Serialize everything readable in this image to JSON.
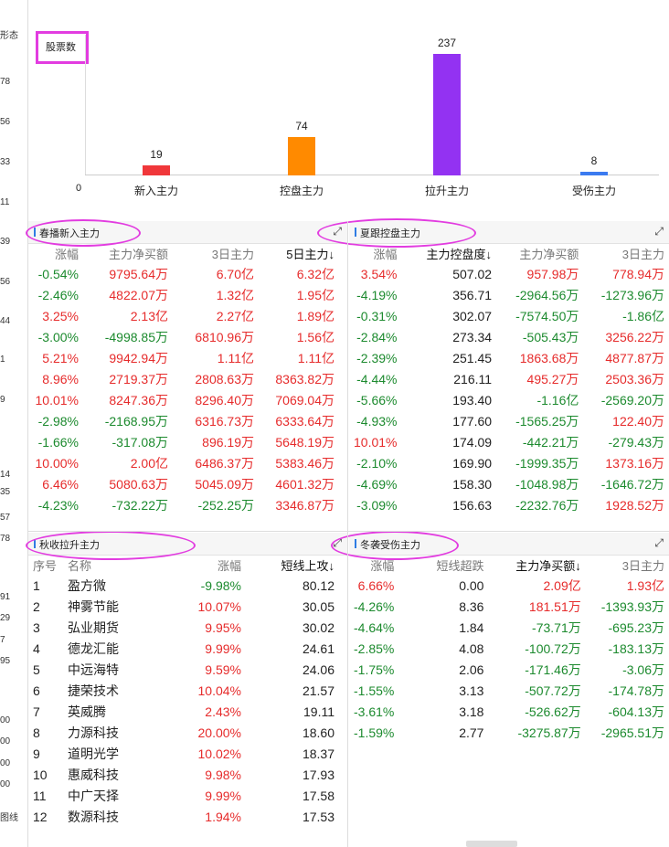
{
  "left_strip": [
    "形态",
    "78",
    "56",
    "33",
    "11",
    "39",
    "56",
    "44",
    "1",
    "9",
    "14",
    "35",
    "57",
    "78",
    "91",
    "29",
    "7",
    "95",
    "00",
    "00",
    "00",
    "00",
    "图线"
  ],
  "chart": {
    "title": "股票数",
    "zero_label": "0"
  },
  "chart_data": {
    "type": "bar",
    "title": "股票数",
    "categories": [
      "新入主力",
      "控盘主力",
      "拉升主力",
      "受伤主力"
    ],
    "values": [
      19,
      74,
      237,
      8
    ],
    "colors": [
      "#f0373a",
      "#ff8a00",
      "#9332f2",
      "#3b7bf0"
    ],
    "ylim": [
      0,
      237
    ]
  },
  "panels": {
    "p1": {
      "title": "春播新入主力",
      "headers": [
        "涨幅",
        "主力净买额",
        "3日主力",
        "5日主力↓"
      ],
      "rows": [
        {
          "c": [
            "-0.54%",
            "9795.64万",
            "6.70亿",
            "6.32亿"
          ],
          "t": [
            "down",
            "up",
            "up",
            "up"
          ]
        },
        {
          "c": [
            "-2.46%",
            "4822.07万",
            "1.32亿",
            "1.95亿"
          ],
          "t": [
            "down",
            "up",
            "up",
            "up"
          ]
        },
        {
          "c": [
            "3.25%",
            "2.13亿",
            "2.27亿",
            "1.89亿"
          ],
          "t": [
            "up",
            "up",
            "up",
            "up"
          ]
        },
        {
          "c": [
            "-3.00%",
            "-4998.85万",
            "6810.96万",
            "1.56亿"
          ],
          "t": [
            "down",
            "down",
            "up",
            "up"
          ]
        },
        {
          "c": [
            "5.21%",
            "9942.94万",
            "1.11亿",
            "1.11亿"
          ],
          "t": [
            "up",
            "up",
            "up",
            "up"
          ]
        },
        {
          "c": [
            "8.96%",
            "2719.37万",
            "2808.63万",
            "8363.82万"
          ],
          "t": [
            "up",
            "up",
            "up",
            "up"
          ]
        },
        {
          "c": [
            "10.01%",
            "8247.36万",
            "8296.40万",
            "7069.04万"
          ],
          "t": [
            "up",
            "up",
            "up",
            "up"
          ]
        },
        {
          "c": [
            "-2.98%",
            "-2168.95万",
            "6316.73万",
            "6333.64万"
          ],
          "t": [
            "down",
            "down",
            "up",
            "up"
          ]
        },
        {
          "c": [
            "-1.66%",
            "-317.08万",
            "896.19万",
            "5648.19万"
          ],
          "t": [
            "down",
            "down",
            "up",
            "up"
          ]
        },
        {
          "c": [
            "10.00%",
            "2.00亿",
            "6486.37万",
            "5383.46万"
          ],
          "t": [
            "up",
            "up",
            "up",
            "up"
          ]
        },
        {
          "c": [
            "6.46%",
            "5080.63万",
            "5045.09万",
            "4601.32万"
          ],
          "t": [
            "up",
            "up",
            "up",
            "up"
          ]
        },
        {
          "c": [
            "-4.23%",
            "-732.22万",
            "-252.25万",
            "3346.87万"
          ],
          "t": [
            "down",
            "down",
            "down",
            "up"
          ]
        }
      ]
    },
    "p2": {
      "title": "夏跟控盘主力",
      "headers": [
        "涨幅",
        "主力控盘度↓",
        "主力净买额",
        "3日主力"
      ],
      "rows": [
        {
          "c": [
            "3.54%",
            "507.02",
            "957.98万",
            "778.94万"
          ],
          "t": [
            "up",
            "neu",
            "up",
            "up"
          ]
        },
        {
          "c": [
            "-4.19%",
            "356.71",
            "-2964.56万",
            "-1273.96万"
          ],
          "t": [
            "down",
            "neu",
            "down",
            "down"
          ]
        },
        {
          "c": [
            "-0.31%",
            "302.07",
            "-7574.50万",
            "-1.86亿"
          ],
          "t": [
            "down",
            "neu",
            "down",
            "down"
          ]
        },
        {
          "c": [
            "-2.84%",
            "273.34",
            "-505.43万",
            "3256.22万"
          ],
          "t": [
            "down",
            "neu",
            "down",
            "up"
          ]
        },
        {
          "c": [
            "-2.39%",
            "251.45",
            "1863.68万",
            "4877.87万"
          ],
          "t": [
            "down",
            "neu",
            "up",
            "up"
          ]
        },
        {
          "c": [
            "-4.44%",
            "216.11",
            "495.27万",
            "2503.36万"
          ],
          "t": [
            "down",
            "neu",
            "up",
            "up"
          ]
        },
        {
          "c": [
            "-5.66%",
            "193.40",
            "-1.16亿",
            "-2569.20万"
          ],
          "t": [
            "down",
            "neu",
            "down",
            "down"
          ]
        },
        {
          "c": [
            "-4.93%",
            "177.60",
            "-1565.25万",
            "122.40万"
          ],
          "t": [
            "down",
            "neu",
            "down",
            "up"
          ]
        },
        {
          "c": [
            "10.01%",
            "174.09",
            "-442.21万",
            "-279.43万"
          ],
          "t": [
            "up",
            "neu",
            "down",
            "down"
          ]
        },
        {
          "c": [
            "-2.10%",
            "169.90",
            "-1999.35万",
            "1373.16万"
          ],
          "t": [
            "down",
            "neu",
            "down",
            "up"
          ]
        },
        {
          "c": [
            "-4.69%",
            "158.30",
            "-1048.98万",
            "-1646.72万"
          ],
          "t": [
            "down",
            "neu",
            "down",
            "down"
          ]
        },
        {
          "c": [
            "-3.09%",
            "156.63",
            "-2232.76万",
            "1928.52万"
          ],
          "t": [
            "down",
            "neu",
            "down",
            "up"
          ]
        }
      ]
    },
    "p3": {
      "title": "秋收拉升主力",
      "headers": [
        "序号",
        "名称",
        "涨幅",
        "短线上攻↓"
      ],
      "rows": [
        {
          "c": [
            "1",
            "盈方微",
            "-9.98%",
            "80.12"
          ],
          "t": [
            "neu",
            "neu",
            "down",
            "neu"
          ]
        },
        {
          "c": [
            "2",
            "神雾节能",
            "10.07%",
            "30.05"
          ],
          "t": [
            "neu",
            "neu",
            "up",
            "neu"
          ]
        },
        {
          "c": [
            "3",
            "弘业期货",
            "9.95%",
            "30.02"
          ],
          "t": [
            "neu",
            "neu",
            "up",
            "neu"
          ]
        },
        {
          "c": [
            "4",
            "德龙汇能",
            "9.99%",
            "24.61"
          ],
          "t": [
            "neu",
            "neu",
            "up",
            "neu"
          ]
        },
        {
          "c": [
            "5",
            "中远海特",
            "9.59%",
            "24.06"
          ],
          "t": [
            "neu",
            "neu",
            "up",
            "neu"
          ]
        },
        {
          "c": [
            "6",
            "捷荣技术",
            "10.04%",
            "21.57"
          ],
          "t": [
            "neu",
            "neu",
            "up",
            "neu"
          ]
        },
        {
          "c": [
            "7",
            "英威腾",
            "2.43%",
            "19.11"
          ],
          "t": [
            "neu",
            "neu",
            "up",
            "neu"
          ]
        },
        {
          "c": [
            "8",
            "力源科技",
            "20.00%",
            "18.60"
          ],
          "t": [
            "neu",
            "neu",
            "up",
            "neu"
          ]
        },
        {
          "c": [
            "9",
            "道明光学",
            "10.02%",
            "18.37"
          ],
          "t": [
            "neu",
            "neu",
            "up",
            "neu"
          ]
        },
        {
          "c": [
            "10",
            "惠威科技",
            "9.98%",
            "17.93"
          ],
          "t": [
            "neu",
            "neu",
            "up",
            "neu"
          ]
        },
        {
          "c": [
            "11",
            "中广天择",
            "9.99%",
            "17.58"
          ],
          "t": [
            "neu",
            "neu",
            "up",
            "neu"
          ]
        },
        {
          "c": [
            "12",
            "数源科技",
            "1.94%",
            "17.53"
          ],
          "t": [
            "neu",
            "neu",
            "up",
            "neu"
          ]
        }
      ]
    },
    "p4": {
      "title": "冬袭受伤主力",
      "headers": [
        "涨幅",
        "短线超跌",
        "主力净买额↓",
        "3日主力"
      ],
      "rows": [
        {
          "c": [
            "6.66%",
            "0.00",
            "2.09亿",
            "1.93亿"
          ],
          "t": [
            "up",
            "neu",
            "up",
            "up"
          ]
        },
        {
          "c": [
            "-4.26%",
            "8.36",
            "181.51万",
            "-1393.93万"
          ],
          "t": [
            "down",
            "neu",
            "up",
            "down"
          ]
        },
        {
          "c": [
            "-4.64%",
            "1.84",
            "-73.71万",
            "-695.23万"
          ],
          "t": [
            "down",
            "neu",
            "down",
            "down"
          ]
        },
        {
          "c": [
            "-2.85%",
            "4.08",
            "-100.72万",
            "-183.13万"
          ],
          "t": [
            "down",
            "neu",
            "down",
            "down"
          ]
        },
        {
          "c": [
            "-1.75%",
            "2.06",
            "-171.46万",
            "-3.06万"
          ],
          "t": [
            "down",
            "neu",
            "down",
            "down"
          ]
        },
        {
          "c": [
            "-1.55%",
            "3.13",
            "-507.72万",
            "-174.78万"
          ],
          "t": [
            "down",
            "neu",
            "down",
            "down"
          ]
        },
        {
          "c": [
            "-3.61%",
            "3.18",
            "-526.62万",
            "-604.13万"
          ],
          "t": [
            "down",
            "neu",
            "down",
            "down"
          ]
        },
        {
          "c": [
            "-1.59%",
            "2.77",
            "-3275.87万",
            "-2965.51万"
          ],
          "t": [
            "down",
            "neu",
            "down",
            "down"
          ]
        }
      ]
    }
  }
}
